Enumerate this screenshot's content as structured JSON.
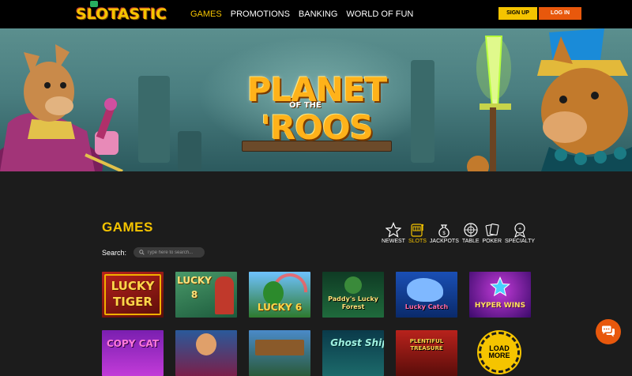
{
  "header": {
    "logo": "SLOTASTIC",
    "nav": [
      "GAMES",
      "PROMOTIONS",
      "BANKING",
      "WORLD OF FUN"
    ],
    "active_nav": "GAMES",
    "signup_label": "SIGN UP",
    "login_label": "LOG IN",
    "colors": {
      "accent": "#f5c400",
      "login": "#e8580c"
    }
  },
  "hero": {
    "title_line1": "PLANET",
    "title_line2": "OF THE",
    "title_line3": "'ROOS"
  },
  "games": {
    "title": "GAMES",
    "categories": [
      {
        "label": "NEWEST",
        "icon": "star-icon"
      },
      {
        "label": "SLOTS",
        "icon": "slot-machine-icon",
        "active": true
      },
      {
        "label": "JACKPOTS",
        "icon": "money-bag-icon"
      },
      {
        "label": "TABLE",
        "icon": "roulette-icon"
      },
      {
        "label": "POKER",
        "icon": "cards-icon"
      },
      {
        "label": "SPECIALTY",
        "icon": "specialty-icon"
      }
    ],
    "search_label": "Search:",
    "search_placeholder": "Type here to search...",
    "tiles": [
      {
        "name": "LUCKY TIGER"
      },
      {
        "name": "LUCKY 8"
      },
      {
        "name": "LUCKY 6"
      },
      {
        "name": "Paddy's Lucky Forest"
      },
      {
        "name": "Lucky Catch"
      },
      {
        "name": "HYPER WINS"
      },
      {
        "name": "COPY CAT"
      },
      {
        "name": ""
      },
      {
        "name": ""
      },
      {
        "name": "Ghost Ship"
      },
      {
        "name": "PLENTIFUL TREASURE"
      }
    ],
    "load_more": "LOAD MORE"
  },
  "chat": {
    "icon": "chat-icon"
  }
}
